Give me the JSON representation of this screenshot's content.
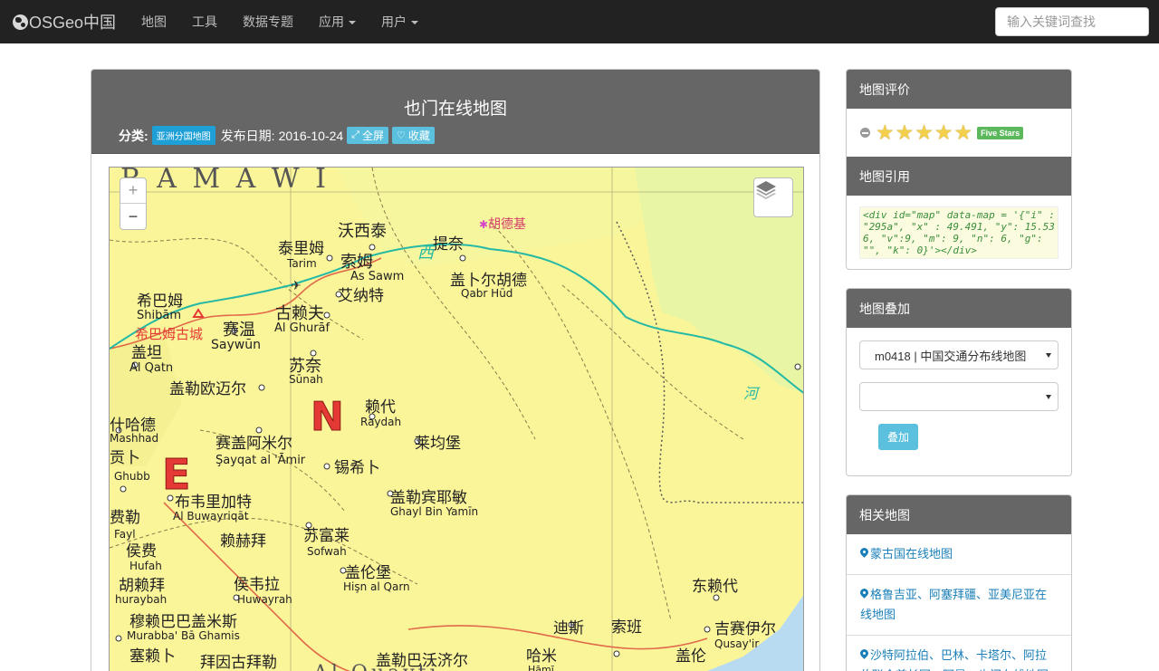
{
  "navbar": {
    "brand": "OSGeo中国",
    "items": [
      {
        "label": "地图",
        "dropdown": false
      },
      {
        "label": "工具",
        "dropdown": false
      },
      {
        "label": "数据专题",
        "dropdown": false
      },
      {
        "label": "应用",
        "dropdown": true
      },
      {
        "label": "用户",
        "dropdown": true
      }
    ],
    "search_placeholder": "输入关键词查找"
  },
  "main": {
    "title": "也门在线地图",
    "category_label": "分类:",
    "category": "亚洲分国地图",
    "date_label": "发布日期:",
    "date": "2016-10-24",
    "fullscreen_label": "全屏",
    "favorite_label": "收藏",
    "zoom_in": "+",
    "zoom_out": "−"
  },
  "map_labels": [
    {
      "text": "R A M A W I"
    },
    {
      "text": "沃西泰"
    },
    {
      "text": "胡德基"
    },
    {
      "text": "泰里姆"
    },
    {
      "text": "Tarim"
    },
    {
      "text": "索姆"
    },
    {
      "text": "As Sawm"
    },
    {
      "text": "提奈"
    },
    {
      "text": "盖卜尔胡德"
    },
    {
      "text": "Qabr Hūd"
    },
    {
      "text": "希巴姆"
    },
    {
      "text": "Shibām"
    },
    {
      "text": "希巴姆古城"
    },
    {
      "text": "艾纳特"
    },
    {
      "text": "古赖夫"
    },
    {
      "text": "Al Ghurāf"
    },
    {
      "text": "赛温"
    },
    {
      "text": "Saywūn"
    },
    {
      "text": "盖坦"
    },
    {
      "text": "Al Qatn"
    },
    {
      "text": "苏奈"
    },
    {
      "text": "Sūnah"
    },
    {
      "text": "盖勒欧迈尔"
    },
    {
      "text": "赖代"
    },
    {
      "text": "Raydah"
    },
    {
      "text": "什哈德"
    },
    {
      "text": "Mashhad"
    },
    {
      "text": "赛盖阿米尔"
    },
    {
      "text": "Şayqat al 'Āmir"
    },
    {
      "text": "莱均堡"
    },
    {
      "text": "贡卜"
    },
    {
      "text": "Ghubb"
    },
    {
      "text": "锡希卜"
    },
    {
      "text": "布韦里加特"
    },
    {
      "text": "Al Buwayriqāt"
    },
    {
      "text": "盖勒宾耶敏"
    },
    {
      "text": "Ghayl Bin Yamīn"
    },
    {
      "text": "费勒"
    },
    {
      "text": "Fayl"
    },
    {
      "text": "赖赫拜"
    },
    {
      "text": "苏富莱"
    },
    {
      "text": "Sofwah"
    },
    {
      "text": "侯费"
    },
    {
      "text": "Hufah"
    },
    {
      "text": "侯韦拉"
    },
    {
      "text": "Huwayrah"
    },
    {
      "text": "盖伦堡"
    },
    {
      "text": "Hişn al Qarn"
    },
    {
      "text": "胡赖拜"
    },
    {
      "text": "huraybah"
    },
    {
      "text": "穆赖巴巴盖米斯"
    },
    {
      "text": "Murabba' Bā Ghamis"
    },
    {
      "text": "塞赖卜"
    },
    {
      "text": "拜因古拜勒"
    },
    {
      "text": "迪斯"
    },
    {
      "text": "索班"
    },
    {
      "text": "哈米"
    },
    {
      "text": "Ḥāmī"
    },
    {
      "text": "吉赛伊尔"
    },
    {
      "text": "Qusay'ir"
    },
    {
      "text": "盖伦"
    },
    {
      "text": "东赖代"
    },
    {
      "text": "盖勒巴沃济尔"
    },
    {
      "text": "西"
    },
    {
      "text": "河"
    },
    {
      "text": "E"
    },
    {
      "text": "N"
    },
    {
      "text": "Al Quayti"
    }
  ],
  "sidebar": {
    "rating": {
      "title": "地图评价",
      "stars": 5,
      "badge": "Five Stars"
    },
    "cite": {
      "title": "地图引用",
      "code": "<div id=\"map\" data-map = '{\"i\" : \"295a\", \"x\" : 49.491, \"y\": 15.536, \"v\":9, \"m\": 9, \"n\": 6, \"g\": \"\", \"k\": 0}'></div>"
    },
    "overlay": {
      "title": "地图叠加",
      "select1_value": "m0418 | 中国交通分布线地图",
      "select2_value": "",
      "button_label": "叠加"
    },
    "related": {
      "title": "相关地图",
      "items": [
        "蒙古国在线地图",
        "格鲁吉亚、阿塞拜疆、亚美尼亚在线地图",
        "沙特阿拉伯、巴林、卡塔尔、阿拉伯联合酋长国、阿曼、也门在线地图"
      ]
    }
  },
  "colors": {
    "navbar_bg": "#222222",
    "panel_head_bg": "#666666",
    "info_button": "#5bc0de",
    "category_label": "#1ea0d6",
    "success_badge": "#5cb85c",
    "link": "#1a7fb8",
    "map_land": "#fbf59a",
    "map_green": "#e7f5a4",
    "map_sea": "#b9dbf2"
  }
}
